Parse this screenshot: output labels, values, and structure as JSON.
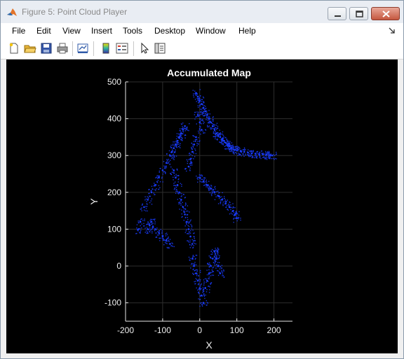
{
  "window": {
    "title": "Figure 5: Point Cloud Player"
  },
  "menu": {
    "items": [
      "File",
      "Edit",
      "View",
      "Insert",
      "Tools",
      "Desktop",
      "Window",
      "Help"
    ]
  },
  "toolbar": {
    "icons": [
      "new-figure-icon",
      "open-icon",
      "save-icon",
      "print-icon",
      "link-plot-icon",
      "insert-colorbar-icon",
      "insert-legend-icon",
      "edit-plot-icon",
      "property-inspector-icon"
    ]
  },
  "colors": {
    "points": "#1a3cff",
    "background": "#000000",
    "grid": "#2e2e2e"
  },
  "chart_data": {
    "type": "scatter",
    "title": "Accumulated Map",
    "xlabel": "X",
    "ylabel": "Y",
    "xlim": [
      -200,
      250
    ],
    "ylim": [
      -150,
      500
    ],
    "xticks": [
      -200,
      -100,
      0,
      100,
      200
    ],
    "yticks": [
      -100,
      0,
      100,
      200,
      300,
      400,
      500
    ],
    "grid": true,
    "series": [
      {
        "marker_color": "#1a3cff",
        "x": [
          -10,
          -5,
          0,
          5,
          10,
          -5,
          0,
          5,
          -10,
          -15,
          -20,
          -25,
          -30,
          15,
          20,
          25,
          30,
          35,
          40,
          45,
          50,
          55,
          60,
          65,
          70,
          75,
          80,
          85,
          90,
          95,
          100,
          110,
          120,
          130,
          140,
          150,
          160,
          170,
          180,
          190,
          195,
          -40,
          -45,
          -50,
          -55,
          -60,
          -65,
          -70,
          -75,
          -80,
          -90,
          -100,
          -110,
          -120,
          -130,
          -140,
          -150,
          -160,
          -165,
          -70,
          -65,
          -60,
          -55,
          -50,
          -45,
          -40,
          -35,
          -30,
          -25,
          -20,
          0,
          10,
          20,
          30,
          40,
          50,
          60,
          70,
          80,
          90,
          95,
          100,
          -120,
          -110,
          -100,
          -90,
          -80,
          -130,
          -135,
          -140,
          40,
          45,
          50,
          55,
          -20,
          -15,
          -10,
          -5,
          0,
          5,
          10,
          15,
          20,
          25,
          30,
          35,
          40
        ],
        "y": [
          470,
          460,
          450,
          440,
          430,
          410,
          390,
          370,
          350,
          330,
          310,
          290,
          270,
          420,
          410,
          400,
          390,
          380,
          370,
          360,
          355,
          350,
          345,
          340,
          335,
          330,
          325,
          320,
          318,
          316,
          314,
          312,
          310,
          308,
          306,
          305,
          304,
          303,
          302,
          301,
          300,
          380,
          370,
          360,
          350,
          340,
          330,
          320,
          310,
          300,
          280,
          260,
          240,
          220,
          200,
          180,
          160,
          120,
          100,
          260,
          240,
          220,
          200,
          180,
          160,
          140,
          120,
          100,
          80,
          60,
          240,
          230,
          220,
          210,
          200,
          190,
          180,
          170,
          160,
          150,
          140,
          130,
          100,
          90,
          80,
          70,
          60,
          120,
          110,
          100,
          40,
          20,
          0,
          -20,
          20,
          0,
          -20,
          -40,
          -60,
          -80,
          -100,
          -60,
          -40,
          -20,
          0,
          20,
          40
        ]
      }
    ]
  }
}
